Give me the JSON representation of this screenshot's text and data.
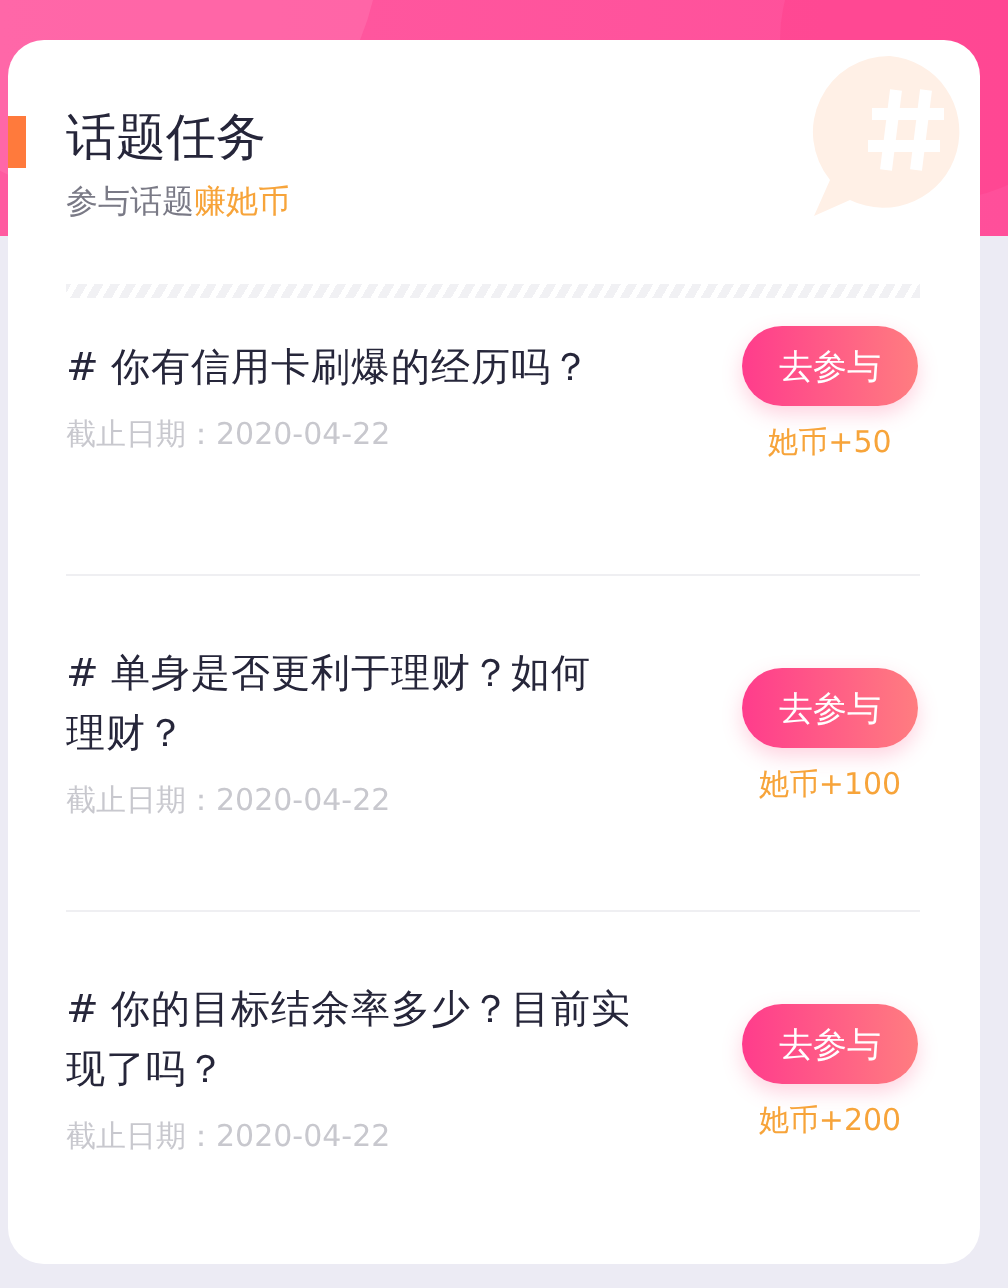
{
  "header": {
    "title": "话题任务",
    "subtitle": "参与话题",
    "subtitle_highlight": "赚她币"
  },
  "topics": [
    {
      "title": "# 你有信用卡刷爆的经历吗？",
      "deadline": "截止日期：2020-04-22",
      "button": "去参与",
      "reward": "她币+50"
    },
    {
      "title": "# 单身是否更利于理财？如何理财？",
      "deadline": "截止日期：2020-04-22",
      "button": "去参与",
      "reward": "她币+100"
    },
    {
      "title": "# 你的目标结余率多少？目前实现了吗？",
      "deadline": "截止日期：2020-04-22",
      "button": "去参与",
      "reward": "她币+200"
    }
  ]
}
